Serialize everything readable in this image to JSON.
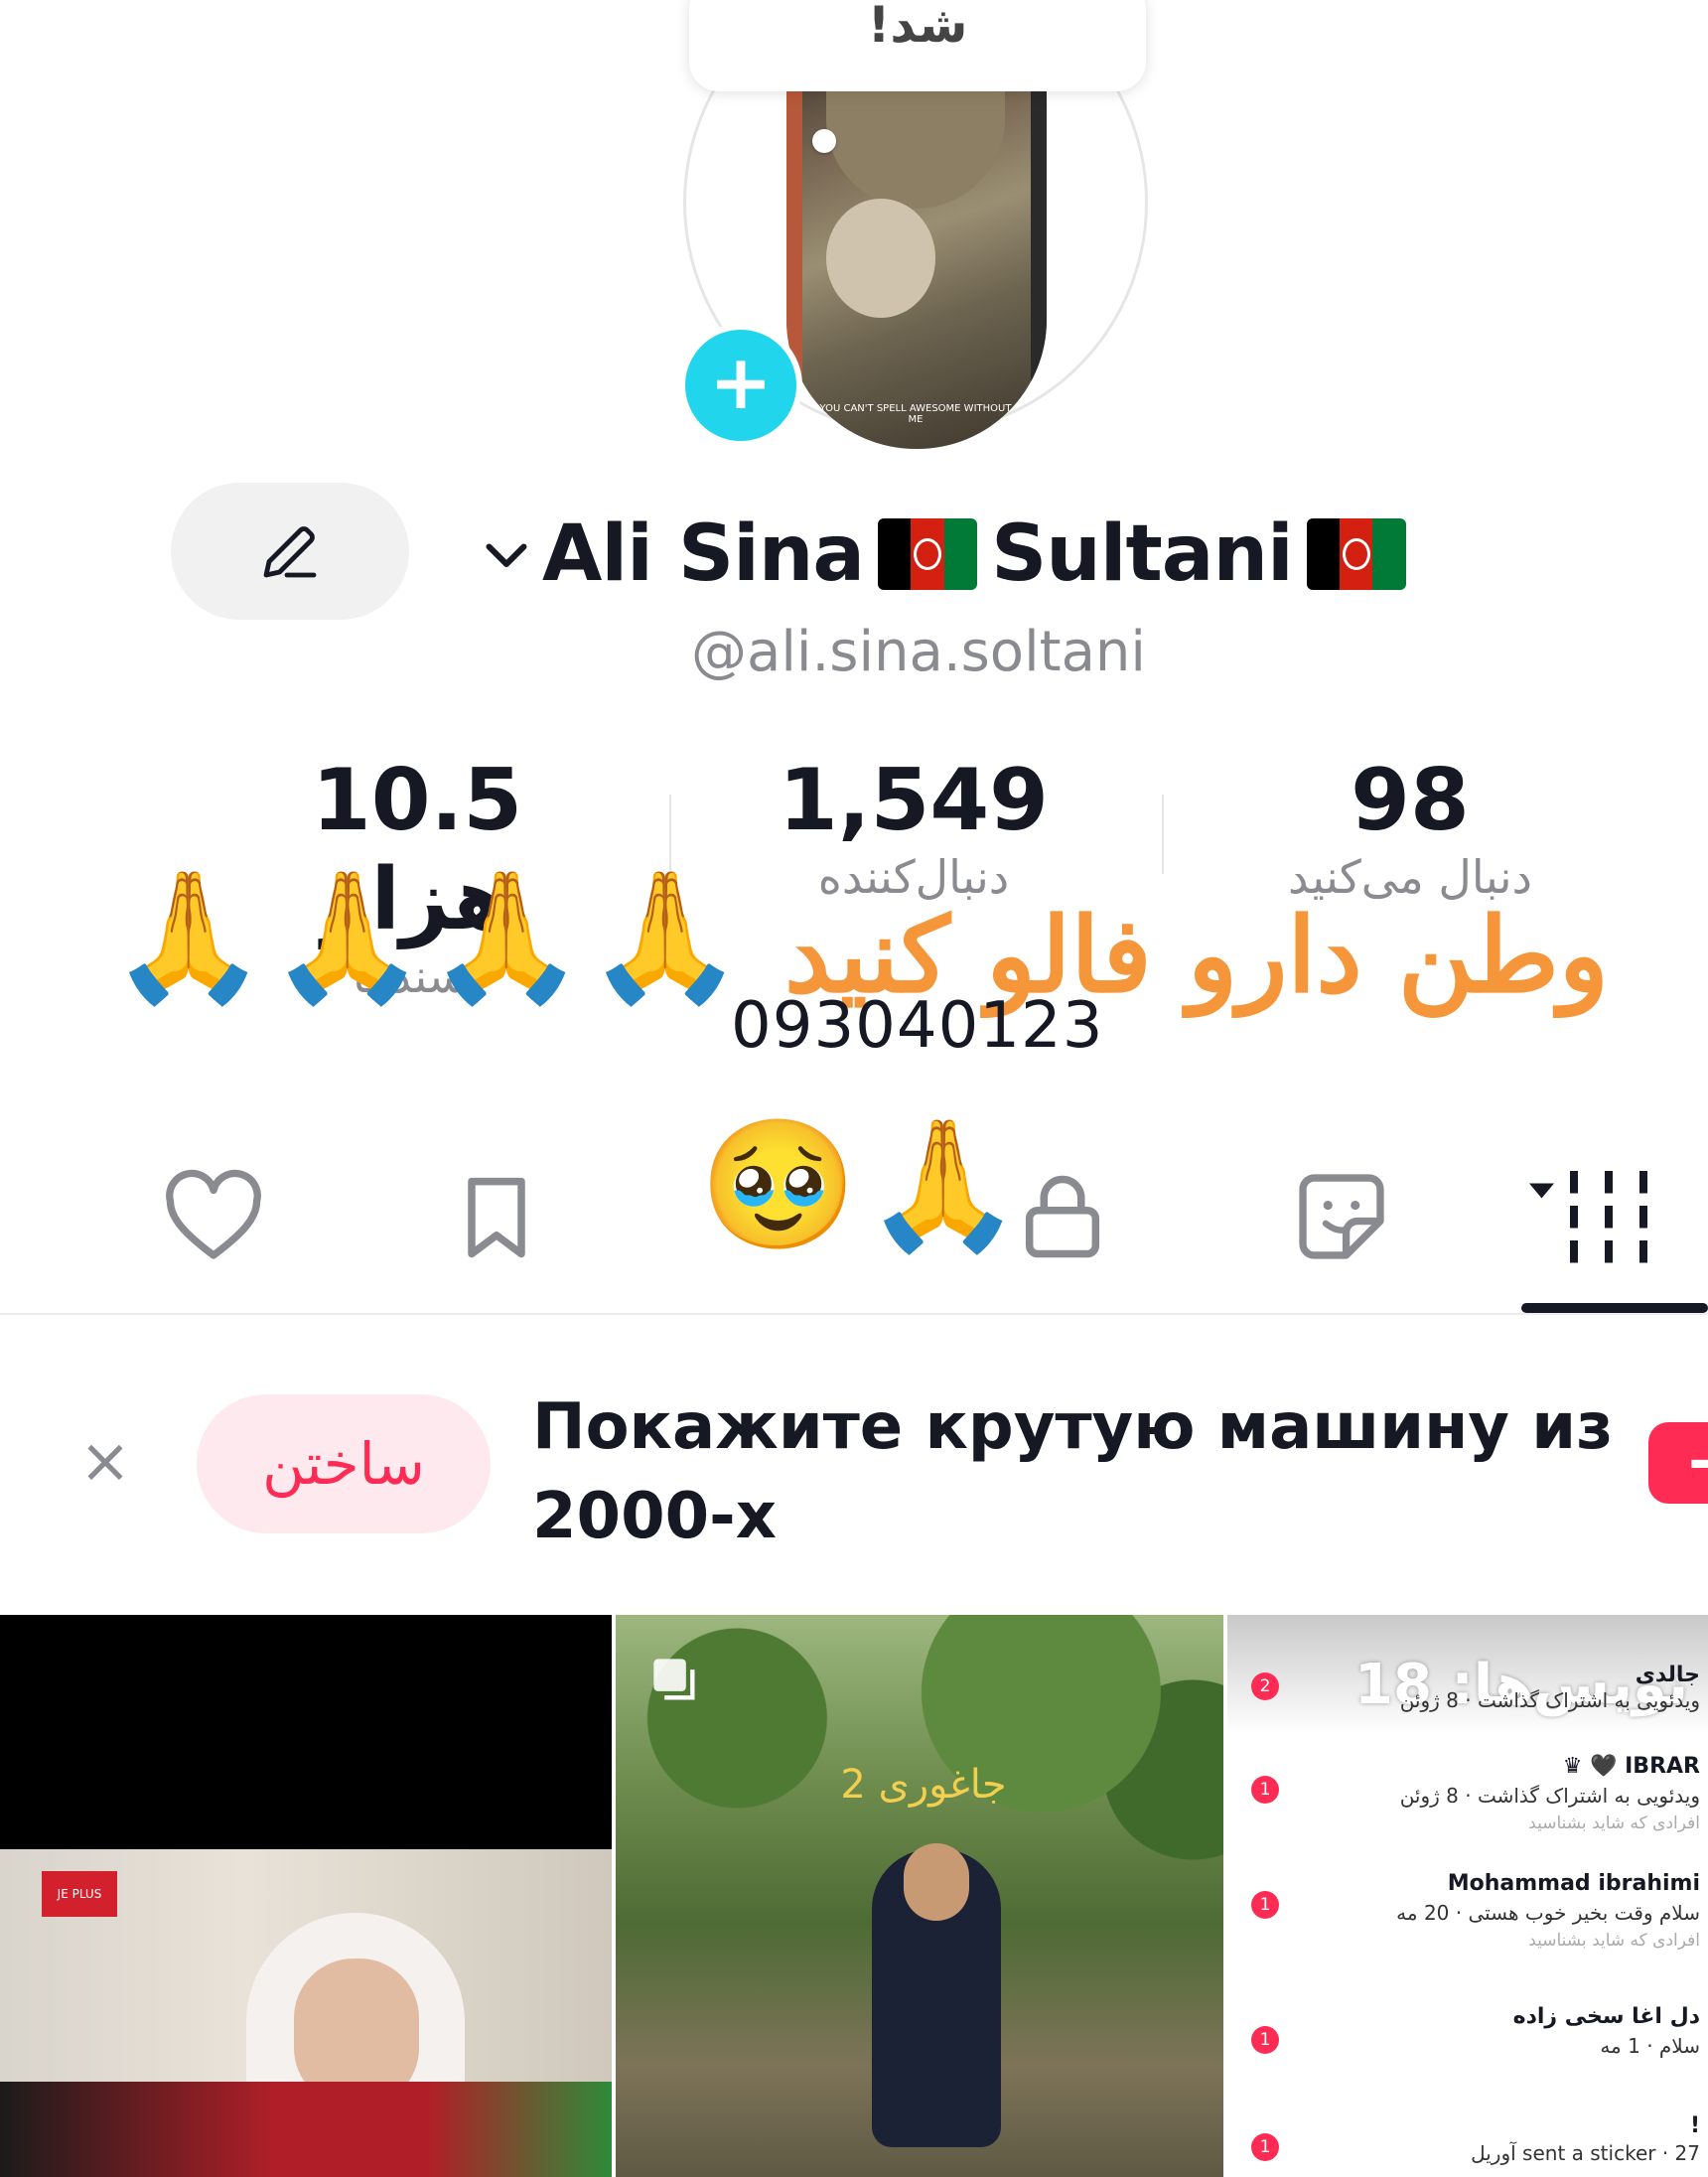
{
  "profile": {
    "tooltip_text": "!شد",
    "display_name_part1": "Ali Sina",
    "display_name_part2": "Sultani",
    "username": "@ali.sina.soltani",
    "avatar_caption": "YOU CAN'T SPELL AWESOME WITHOUT ME"
  },
  "stats": {
    "likes_value": "10.5 هزار",
    "likes_label": "پسندها",
    "followers_value": "1,549",
    "followers_label": "دنبال‌کننده",
    "following_value": "98",
    "following_label": "دنبال می‌کنید"
  },
  "overlay": {
    "orange_text": "وطن دارو فالو کنید",
    "phone_text": "093040123",
    "pray_emoji": "🙏",
    "teary_emoji": "🥹"
  },
  "banner": {
    "create_label": "ساختن",
    "prompt_text": "Покажите крутую машину из 2000-х",
    "close_symbol": "×",
    "plus_symbol": "+"
  },
  "videos": [
    {
      "logo_text": "JE PLUS"
    },
    {
      "label": "جاغوری 2"
    },
    {
      "count_text": "نویس‌ها: 18",
      "rows": [
        {
          "badge": "2",
          "name": "جالدی",
          "message": "ویدئویی به اشتراک گذاشت · 8 ژوئن",
          "sub": ""
        },
        {
          "badge": "1",
          "name": "IBRAR 🖤 ♛",
          "message": "ویدئویی به اشتراک گذاشت · 8 ژوئن",
          "sub": "افرادی که شاید بشناسید"
        },
        {
          "badge": "1",
          "name": "Mohammad  ibrahimi",
          "message": "سلام وقت بخیر خوب هستی · 20 مه",
          "sub": "افرادی که شاید بشناسید"
        },
        {
          "badge": "1",
          "name": "دل اغا سخی زاده",
          "message": "سلام · 1 مه",
          "sub": ""
        },
        {
          "badge": "1",
          "name": "!",
          "message": "sent a sticker · 27 آوریل",
          "sub": ""
        }
      ]
    }
  ],
  "icons": {
    "add": "plus-icon",
    "edit": "pencil-icon",
    "dropdown": "chevron-down-icon",
    "tabs": [
      "heart-icon",
      "bookmark-icon",
      "lock-icon",
      "sticker-icon",
      "grid-icon"
    ]
  },
  "colors": {
    "accent_cyan": "#20d5ec",
    "accent_red": "#fe2c55",
    "orange_text": "#f5963a",
    "flag_black": "#000000",
    "flag_red": "#d32011",
    "flag_green": "#007a36"
  }
}
